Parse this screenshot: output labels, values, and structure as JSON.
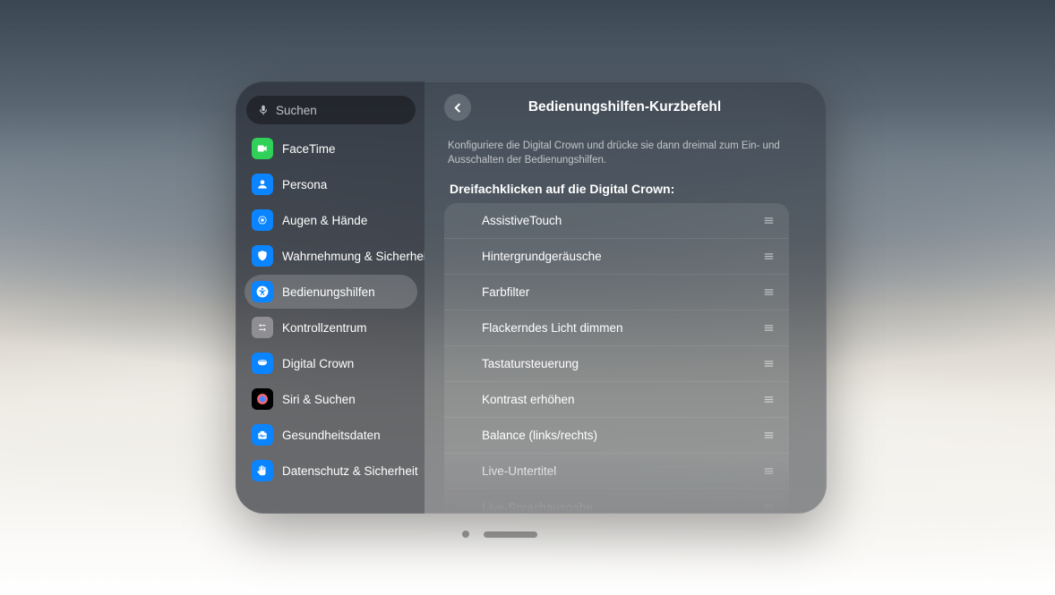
{
  "search": {
    "placeholder": "Suchen"
  },
  "sidebar": {
    "items": [
      {
        "id": "facetime",
        "label": "FaceTime",
        "color": "#30d158",
        "icon": "video"
      },
      {
        "id": "persona",
        "label": "Persona",
        "color": "#0a84ff",
        "icon": "person"
      },
      {
        "id": "augen-haende",
        "label": "Augen & Hände",
        "color": "#0a84ff",
        "icon": "touch"
      },
      {
        "id": "wahrnehmung",
        "label": "Wahrnehmung & Sicherheit",
        "color": "#0a84ff",
        "icon": "shield-person"
      },
      {
        "id": "bedienungshilfen",
        "label": "Bedienungshilfen",
        "color": "#0a84ff",
        "icon": "accessibility",
        "selected": true
      },
      {
        "id": "kontrollzentrum",
        "label": "Kontrollzentrum",
        "color": "#8e8e93",
        "icon": "controls"
      },
      {
        "id": "digital-crown",
        "label": "Digital Crown",
        "color": "#0a84ff",
        "icon": "crown"
      },
      {
        "id": "siri-suchen",
        "label": "Siri & Suchen",
        "color": "siri",
        "icon": "siri"
      },
      {
        "id": "gesundheitsdaten",
        "label": "Gesundheitsdaten",
        "color": "#0a84ff",
        "icon": "health"
      },
      {
        "id": "datenschutz",
        "label": "Datenschutz & Sicherheit",
        "color": "#0a84ff",
        "icon": "hand"
      }
    ]
  },
  "detail": {
    "title": "Bedienungshilfen-Kurzbefehl",
    "description": "Konfiguriere die Digital Crown und drücke sie dann dreimal zum Ein- und Ausschalten der Bedienungshilfen.",
    "section_header": "Dreifachklicken auf die Digital Crown:",
    "shortcuts": [
      {
        "label": "AssistiveTouch"
      },
      {
        "label": "Hintergrundgeräusche"
      },
      {
        "label": "Farbfilter"
      },
      {
        "label": "Flackerndes Licht dimmen"
      },
      {
        "label": "Tastatursteuerung"
      },
      {
        "label": "Kontrast erhöhen"
      },
      {
        "label": "Balance (links/rechts)"
      },
      {
        "label": "Live-Untertitel"
      },
      {
        "label": "Live-Sprachausgabe"
      }
    ]
  }
}
